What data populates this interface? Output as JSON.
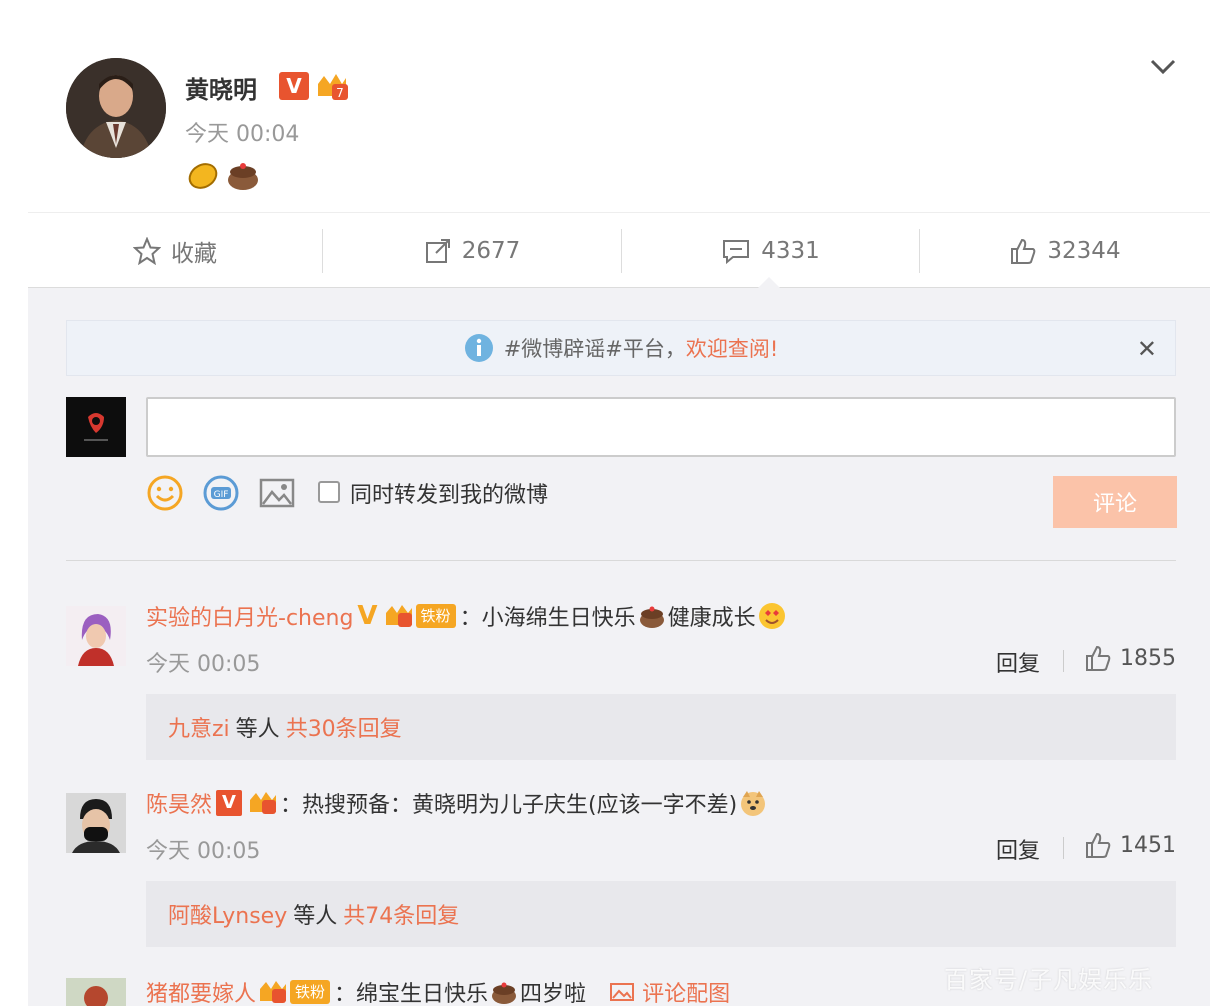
{
  "post": {
    "author": "黄晓明",
    "time": "今天 00:04",
    "verified_mark": "V"
  },
  "actions": {
    "favorite_label": "收藏",
    "repost_count": "2677",
    "comment_count": "4331",
    "like_count": "32344"
  },
  "notice": {
    "text": "#微博辟谣#平台，",
    "link": "欢迎查阅!"
  },
  "composer": {
    "repost_label": "同时转发到我的微博",
    "submit_label": "评论"
  },
  "comments": [
    {
      "user": "实验的白月光-cheng",
      "fan_badge": "铁粉",
      "text_before": "：小海绵生日快乐",
      "text_after": "健康成长",
      "time": "今天 00:05",
      "reply_label": "回复",
      "likes": "1855",
      "replies_user": "九意zi",
      "replies_mid": "等人",
      "replies_count": "共30条回复"
    },
    {
      "user": "陈昊然",
      "text": "：热搜预备：黄晓明为儿子庆生(应该一字不差)",
      "time": "今天 00:05",
      "reply_label": "回复",
      "likes": "1451",
      "replies_user": "阿酸Lynsey",
      "replies_mid": "等人",
      "replies_count": "共74条回复"
    },
    {
      "user": "猪都要嫁人",
      "fan_badge": "铁粉",
      "text_before": "：绵宝生日快乐",
      "text_after": "四岁啦",
      "pic_label": "评论配图"
    }
  ],
  "watermark": "百家号/子凡娱乐乐",
  "colors": {
    "accent": "#eb7350",
    "badge": "#f5a623",
    "submit_disabled": "#fbc3a9",
    "panel": "#f2f2f5"
  }
}
